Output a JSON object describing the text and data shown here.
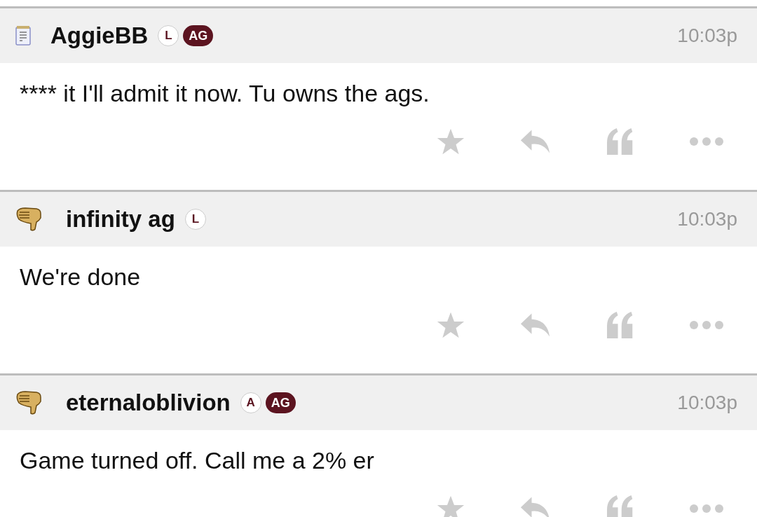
{
  "posts": [
    {
      "avatar": {
        "kind": "notepad"
      },
      "username": "AggieBB",
      "badges": [
        {
          "kind": "circle",
          "label": "L"
        },
        {
          "kind": "pill",
          "label": "AG"
        }
      ],
      "time": "10:03p",
      "body": "**** it I'll admit it now. Tu owns the ags."
    },
    {
      "avatar": {
        "kind": "thumbs-down"
      },
      "username": "infinity ag",
      "badges": [
        {
          "kind": "circle",
          "label": "L"
        }
      ],
      "time": "10:03p",
      "body": "We're done"
    },
    {
      "avatar": {
        "kind": "thumbs-down"
      },
      "username": "eternaloblivion",
      "badges": [
        {
          "kind": "circle",
          "label": "A"
        },
        {
          "kind": "pill",
          "label": "AG"
        }
      ],
      "time": "10:03p",
      "body": "Game turned off. Call me a 2% er"
    }
  ]
}
